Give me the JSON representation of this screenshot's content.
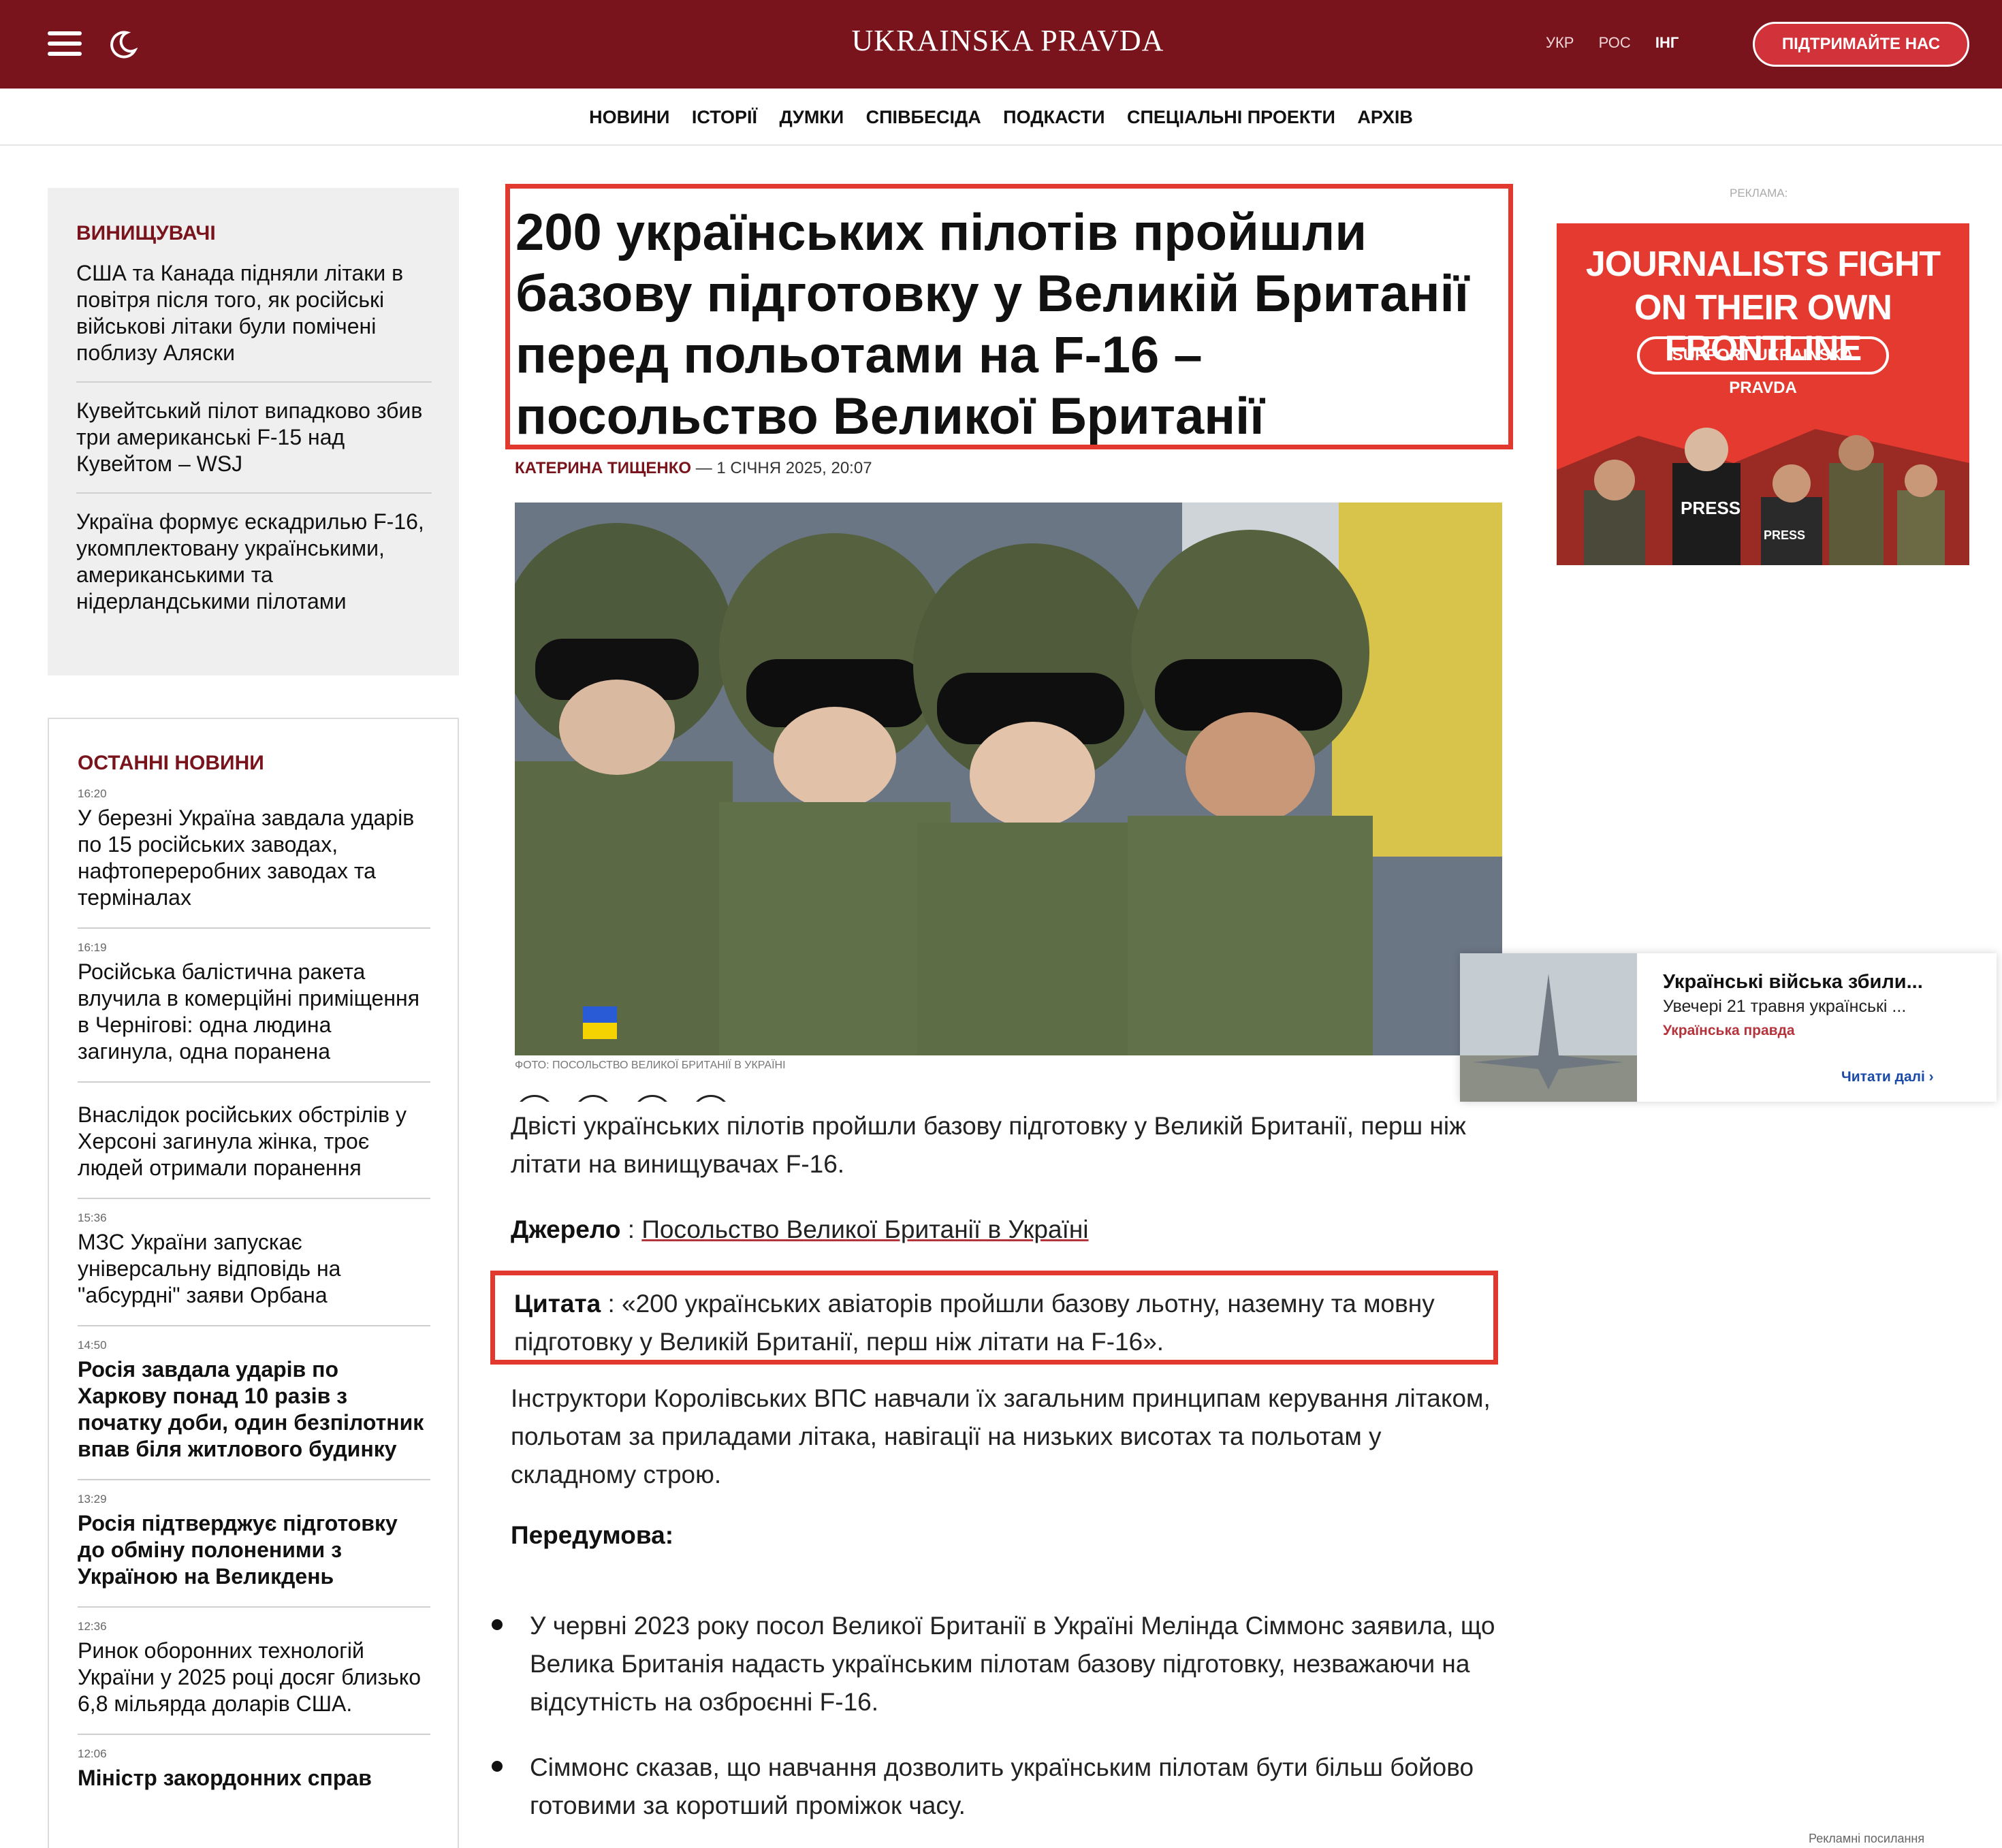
{
  "header": {
    "logo": "UKRAINSKA PRAVDA",
    "languages": [
      "УКР",
      "РОС",
      "ІНГ"
    ],
    "active_language": "ІНГ",
    "support_label": "ПІДТРИМАЙТЕ НАС",
    "brand_color": "#7a141c",
    "accent_color": "#d2323a"
  },
  "nav": [
    "НОВИНИ",
    "ІСТОРІЇ",
    "ДУМКИ",
    "СПІВБЕСІДА",
    "ПОДКАСТИ",
    "СПЕЦІАЛЬНІ ПРОЕКТИ",
    "АРХІВ"
  ],
  "topic": {
    "heading": "ВИНИЩУВАЧІ",
    "items": [
      "США та Канада підняли літаки в повітря після того, як російські військові літаки були помічені поблизу Аляски",
      "Кувейтський пілот випадково збив три американські F-15 над Кувейтом – WSJ",
      "Україна формує ескадрилью F-16, укомплектовану українськими, американськими та нідерландськими пілотами"
    ]
  },
  "latest": {
    "heading": "ОСТАННІ НОВИНИ",
    "items": [
      {
        "time": "16:20",
        "title": "У березні Україна завдала ударів по 15 російських заводах, нафтопереробних заводах та терміналах"
      },
      {
        "time": "16:19",
        "title": "Російська балістична ракета влучила в комерційні приміщення в Чернігові: одна людина загинула, одна поранена"
      }
    ],
    "items_cont": [
      {
        "time": "",
        "title": "Внаслідок російських обстрілів у Херсоні загинула жінка, троє людей отримали поранення"
      },
      {
        "time": "15:36",
        "title": "МЗС України запускає універсальну відповідь на \"абсурдні\" заяви Орбана"
      },
      {
        "time": "14:50",
        "title": "Росія завдала ударів по Харкову понад 10 разів з початку доби, один безпілотник впав біля житлового будинку"
      },
      {
        "time": "13:29",
        "title": "Росія підтверджує підготовку до обміну полоненими з Україною на Великдень"
      },
      {
        "time": "12:36",
        "title": "Ринок оборонних технологій України у 2025 році досяг близько 6,8 мільярда доларів США."
      },
      {
        "time": "12:06",
        "title": "Міністр закордонних справ"
      }
    ]
  },
  "article": {
    "headline": "200 українських пілотів пройшли базову підготовку у Великій Британії перед польотами на F-16 – посольство Великої Британії",
    "author": "КАТЕРИНА ТИЩЕНКО",
    "date": "— 1 СІЧНЯ 2025, 20:07",
    "photo_caption": "ФОТО: ПОСОЛЬСТВО ВЕЛИКОЇ БРИТАНІЇ В УКРАЇНІ",
    "lead": "Двісті українських пілотів пройшли базову підготовку у Великій Британії, перш ніж літати на винищувачах F-16.",
    "source_label": "Джерело",
    "source_link": "Посольство Великої Британії в Україні",
    "quote_label": "Цитата",
    "quote": "«200 українських авіаторів пройшли базову льотну, наземну та мовну підготовку у Великій Британії, перш ніж літати на F-16».",
    "body": "Інструктори Королівських ВПС навчали їх загальним принципам керування літаком, польотам за приладами літака, навігації на низьких висотах та польотам у складному строю.",
    "background_heading": "Передумова:",
    "bullets": [
      "У червні 2023 року посол Великої Британії в Україні Мелінда Сіммонс заявила, що Велика Британія надасть українським пілотам базову підготовку, незважаючи на відсутність на озброєнні F-16.",
      "Сіммонс сказав, що навчання дозволить українським пілотам бути більш бойово готовими за коротший проміжок часу."
    ]
  },
  "ad": {
    "label": "РЕКЛАМА:",
    "line1": "JOURNALISTS FIGHT",
    "line2": "ON THEIR OWN FRONTLINE",
    "button": "SUPPORT UKRAINSKA PRAVDA",
    "badge1": "PRESS",
    "badge2": "PRESS",
    "color": "#e53a2f"
  },
  "popup": {
    "title": "Українські війська збили...",
    "subtitle": "Увечері 21 травня українські ...",
    "source": "Українська правда",
    "more": "Читати далі ›"
  },
  "footer_note": "Рекламні посилання"
}
